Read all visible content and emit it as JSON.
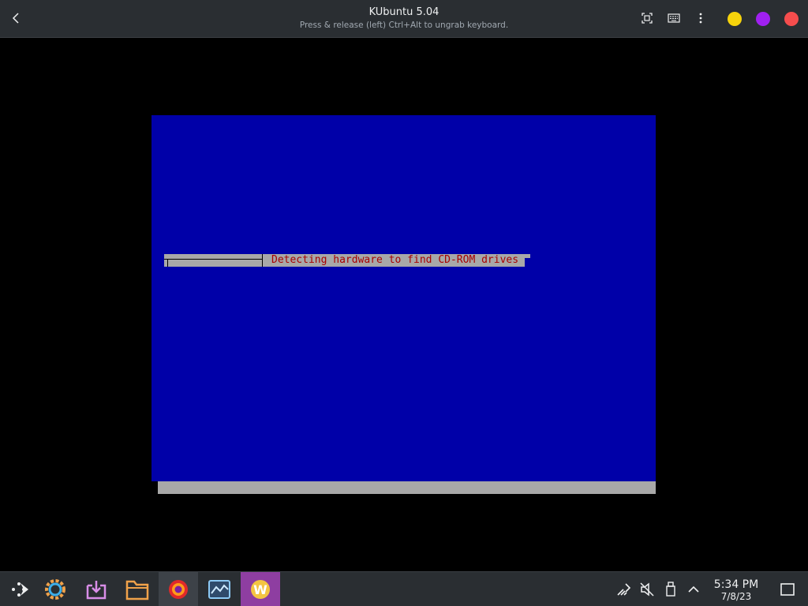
{
  "window": {
    "title": "KUbuntu 5.04",
    "subtitle": "Press & release (left) Ctrl+Alt to ungrab keyboard.",
    "controls": {
      "minimize_color": "#f6d30b",
      "maximize_color": "#a020f0",
      "close_color": "#f54d4d"
    },
    "toolbar_icons": [
      "back-icon",
      "fullscreen-icon",
      "keyboard-icon",
      "menu-kebab-icon"
    ]
  },
  "vm": {
    "screen_color": "#0000a8",
    "shadow_color": "#a8a8a8",
    "progress_text": "Detecting hardware to find CD-ROM drives",
    "text_color": "#a80000"
  },
  "taskbar": {
    "apps": [
      {
        "name": "application-launcher-icon"
      },
      {
        "name": "system-settings-icon"
      },
      {
        "name": "discover-store-icon"
      },
      {
        "name": "file-manager-icon"
      },
      {
        "name": "firefox-icon",
        "active": true
      },
      {
        "name": "system-monitor-icon"
      },
      {
        "name": "w-app-icon",
        "highlight": true
      }
    ],
    "tray": [
      "network-icon",
      "volume-muted-icon",
      "usb-device-icon",
      "tray-expand-icon",
      "show-desktop-icon"
    ],
    "clock": {
      "time": "5:34 PM",
      "date": "7/8/23"
    }
  }
}
